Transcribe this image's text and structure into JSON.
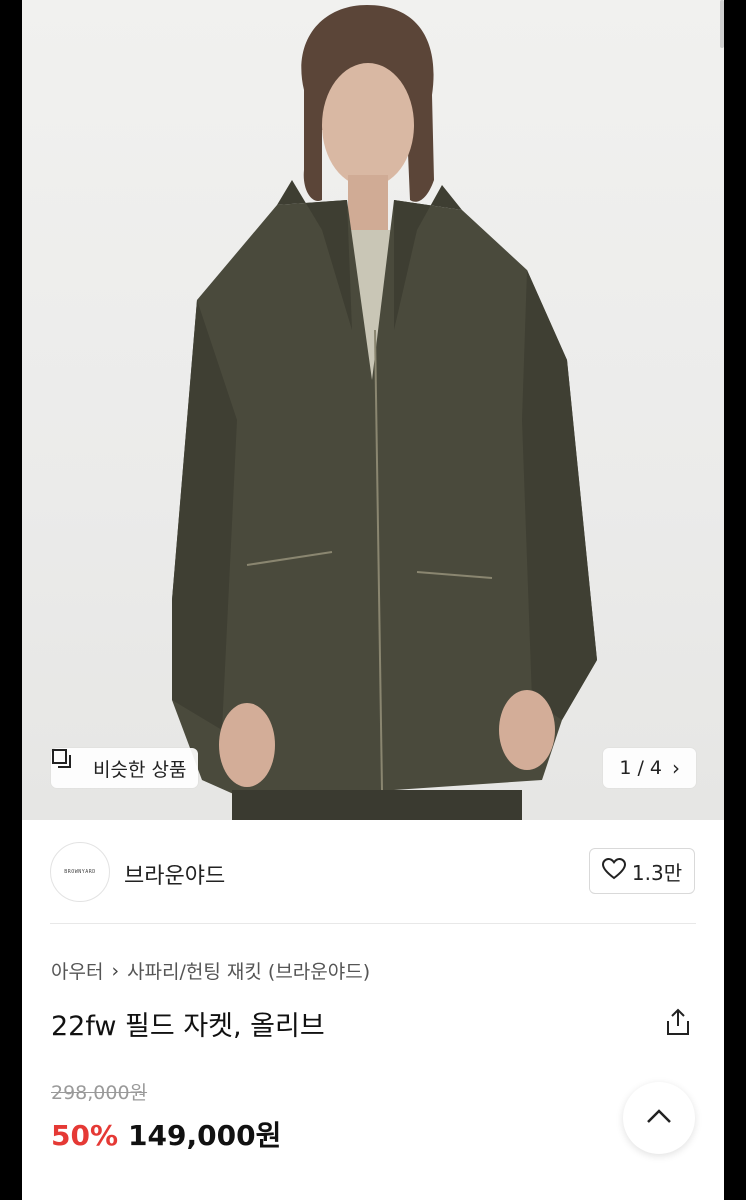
{
  "hero": {
    "similar_label": "비슷한 상품",
    "pager": "1 / 4"
  },
  "seller": {
    "logo_text": "BROWNYARD",
    "name": "브라운야드",
    "likes": "1.3만"
  },
  "product": {
    "breadcrumb": [
      "아우터",
      "사파리/헌팅 재킷 (브라운야드)"
    ],
    "title": "22fw 필드 자켓, 올리브",
    "original_price": "298,000원",
    "discount": "50%",
    "price": "149,000원"
  },
  "colors": {
    "discount": "#e53935",
    "jacket": "#4a4a3c"
  }
}
